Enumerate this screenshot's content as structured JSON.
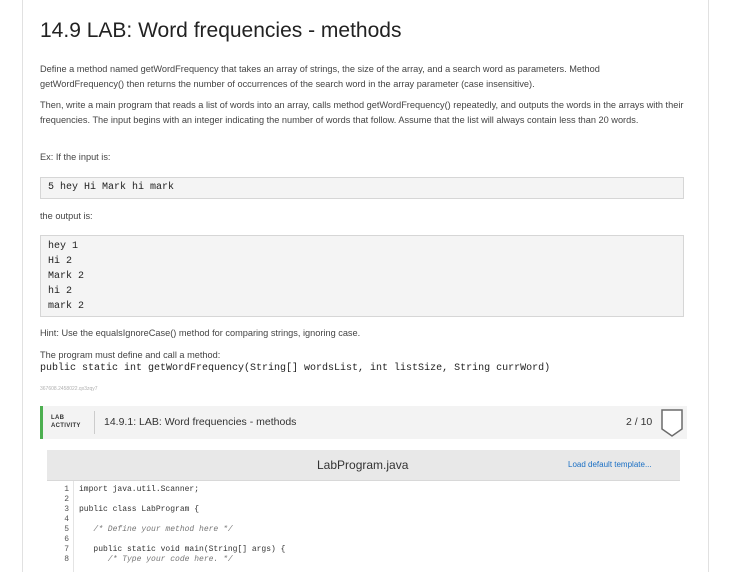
{
  "page": {
    "title": "14.9 LAB: Word frequencies - methods",
    "paragraphs": [
      "Define a method named getWordFrequency that takes an array of strings, the size of the array, and a search word as parameters. Method getWordFrequency() then returns the number of occurrences of the search word in the array parameter (case insensitive).",
      "Then, write a main program that reads a list of words into an array, calls method getWordFrequency() repeatedly, and outputs the words in the arrays with their frequencies. The input begins with an integer indicating the number of words that follow. Assume that the list will always contain less than 20 words.",
      "Ex: If the input is:"
    ],
    "input_example": [
      "5 hey Hi Mark hi mark"
    ],
    "output_label": "the output is:",
    "output_example": [
      "hey 1",
      "Hi 2",
      "Mark 2",
      "hi 2",
      "mark 2"
    ],
    "hint": "Hint: Use the equalsIgnoreCase() method for comparing strings, ignoring case.",
    "must_define": "The program must define and call a method:",
    "signature": "public static int getWordFrequency(String[] wordsList, int listSize, String currWord)",
    "tiny_id": "367608.2458022.qx3zqy7"
  },
  "lab": {
    "tag_line1": "LAB",
    "tag_line2": "ACTIVITY",
    "title": "14.9.1: LAB: Word frequencies - methods",
    "score": "2 / 10",
    "accent_color": "#4caf50"
  },
  "editor": {
    "filename": "LabProgram.java",
    "load_template": "Load default template...",
    "lines": [
      {
        "n": "1",
        "code": "import java.util.Scanner;"
      },
      {
        "n": "2",
        "code": ""
      },
      {
        "n": "3",
        "code": "public class LabProgram {"
      },
      {
        "n": "4",
        "code": ""
      },
      {
        "n": "5",
        "code": "   /* Define your method here */"
      },
      {
        "n": "6",
        "code": ""
      },
      {
        "n": "7",
        "code": "   public static void main(String[] args) {"
      },
      {
        "n": "8",
        "code": "      /* Type your code here. */"
      }
    ]
  }
}
